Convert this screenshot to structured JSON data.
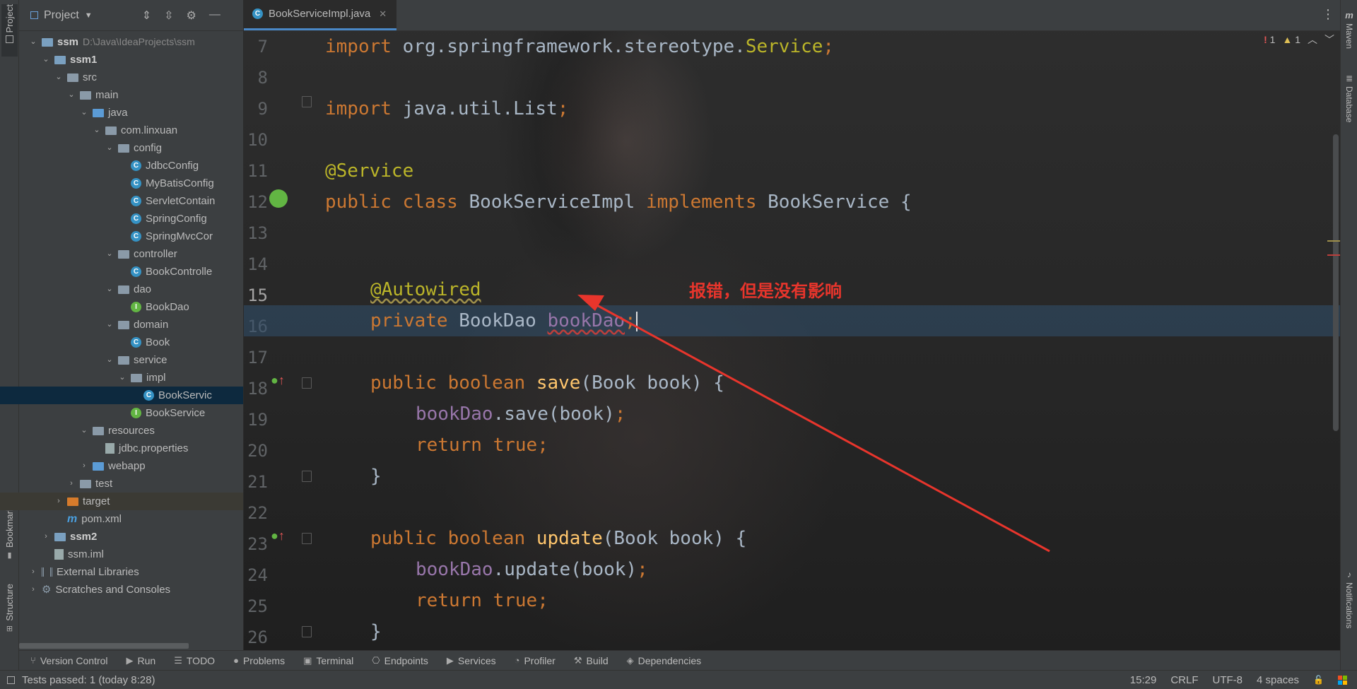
{
  "left_strip": {
    "project": "Project",
    "bookmarks": "Bookmarks",
    "structure": "Structure"
  },
  "right_strip": {
    "maven": "Maven",
    "database": "Database",
    "notifications": "Notifications"
  },
  "project_panel": {
    "title": "Project",
    "tree": [
      {
        "label": "ssm",
        "extra": "D:\\Java\\IdeaProjects\\ssm",
        "depth": 0,
        "arrow": "open",
        "icon": "module-folder",
        "bold": true
      },
      {
        "label": "ssm1",
        "depth": 1,
        "arrow": "open",
        "icon": "module-folder",
        "bold": true
      },
      {
        "label": "src",
        "depth": 2,
        "arrow": "open",
        "icon": "folder"
      },
      {
        "label": "main",
        "depth": 3,
        "arrow": "open",
        "icon": "folder"
      },
      {
        "label": "java",
        "depth": 4,
        "arrow": "open",
        "icon": "source-folder"
      },
      {
        "label": "com.linxuan",
        "depth": 5,
        "arrow": "open",
        "icon": "package"
      },
      {
        "label": "config",
        "depth": 6,
        "arrow": "open",
        "icon": "package"
      },
      {
        "label": "JdbcConfig",
        "depth": 7,
        "icon": "class"
      },
      {
        "label": "MyBatisConfig",
        "depth": 7,
        "icon": "class"
      },
      {
        "label": "ServletContain",
        "depth": 7,
        "icon": "class"
      },
      {
        "label": "SpringConfig",
        "depth": 7,
        "icon": "class"
      },
      {
        "label": "SpringMvcCor",
        "depth": 7,
        "icon": "class"
      },
      {
        "label": "controller",
        "depth": 6,
        "arrow": "open",
        "icon": "package"
      },
      {
        "label": "BookControlle",
        "depth": 7,
        "icon": "class"
      },
      {
        "label": "dao",
        "depth": 6,
        "arrow": "open",
        "icon": "package"
      },
      {
        "label": "BookDao",
        "depth": 7,
        "icon": "interface"
      },
      {
        "label": "domain",
        "depth": 6,
        "arrow": "open",
        "icon": "package"
      },
      {
        "label": "Book",
        "depth": 7,
        "icon": "class"
      },
      {
        "label": "service",
        "depth": 6,
        "arrow": "open",
        "icon": "package"
      },
      {
        "label": "impl",
        "depth": 7,
        "arrow": "open",
        "icon": "package"
      },
      {
        "label": "BookServic",
        "depth": 8,
        "icon": "class",
        "selected": true
      },
      {
        "label": "BookService",
        "depth": 7,
        "icon": "interface"
      },
      {
        "label": "resources",
        "depth": 4,
        "arrow": "open",
        "icon": "resource-folder"
      },
      {
        "label": "jdbc.properties",
        "depth": 5,
        "icon": "file"
      },
      {
        "label": "webapp",
        "depth": 4,
        "arrow": "closed",
        "icon": "web-folder"
      },
      {
        "label": "test",
        "depth": 3,
        "arrow": "closed",
        "icon": "folder"
      },
      {
        "label": "target",
        "depth": 2,
        "arrow": "closed",
        "icon": "excluded-folder",
        "highlight": true
      },
      {
        "label": "pom.xml",
        "depth": 2,
        "icon": "maven"
      },
      {
        "label": "ssm2",
        "depth": 1,
        "arrow": "closed",
        "icon": "module-folder",
        "bold": true
      },
      {
        "label": "ssm.iml",
        "depth": 1,
        "icon": "file"
      },
      {
        "label": "External Libraries",
        "depth": 0,
        "arrow": "closed",
        "icon": "library"
      },
      {
        "label": "Scratches and Consoles",
        "depth": 0,
        "arrow": "closed",
        "icon": "scratches"
      }
    ]
  },
  "editor": {
    "tab_label": "BookServiceImpl.java",
    "inspections": {
      "errors": "1",
      "warnings": "1"
    },
    "line_numbers": [
      "7",
      "8",
      "9",
      "10",
      "11",
      "12",
      "13",
      "14",
      "15",
      "16",
      "17",
      "18",
      "19",
      "20",
      "21",
      "22",
      "23",
      "24",
      "25",
      "26"
    ],
    "current_line": "15",
    "code": {
      "l7_kw": "import",
      "l7_rest": " org.springframework.stereotype.",
      "l7_cls": "Service",
      "l7_semi": ";",
      "l9_kw": "import",
      "l9_rest": " java.util.List",
      "l9_semi": ";",
      "l11_ann": "@Service",
      "l12_kw1": "public class",
      "l12_name": " BookServiceImpl ",
      "l12_kw2": "implements",
      "l12_rest": " BookService {",
      "l14_ann": "@Autowired",
      "l15_kw": "private",
      "l15_type": " BookDao ",
      "l15_field": "bookDao",
      "l15_semi": ";",
      "l17_kw": "public boolean",
      "l17_fn": "save",
      "l17_rest": "(Book book) {",
      "l18_field": "bookDao",
      "l18_rest": ".save(book)",
      "l18_semi": ";",
      "l19_kw": "return true",
      "l19_semi": ";",
      "l20_brace": "}",
      "l22_kw": "public boolean",
      "l22_fn": "update",
      "l22_rest": "(Book book) {",
      "l23_field": "bookDao",
      "l23_rest": ".update(book)",
      "l23_semi": ";",
      "l24_kw": "return true",
      "l24_semi": ";",
      "l25_brace": "}"
    },
    "annotation_text": "报错，但是没有影响"
  },
  "tool_bar": {
    "items": [
      "Version Control",
      "Run",
      "TODO",
      "Problems",
      "Terminal",
      "Endpoints",
      "Services",
      "Profiler",
      "Build",
      "Dependencies"
    ]
  },
  "status_bar": {
    "message": "Tests passed: 1 (today 8:28)",
    "position": "15:29",
    "line_sep": "CRLF",
    "encoding": "UTF-8",
    "indent": "4 spaces"
  },
  "colors": {
    "keyword": "#cc7832",
    "annotation": "#bbb529",
    "field": "#9876aa",
    "method": "#ffc66d",
    "arrow": "#e8352c"
  }
}
